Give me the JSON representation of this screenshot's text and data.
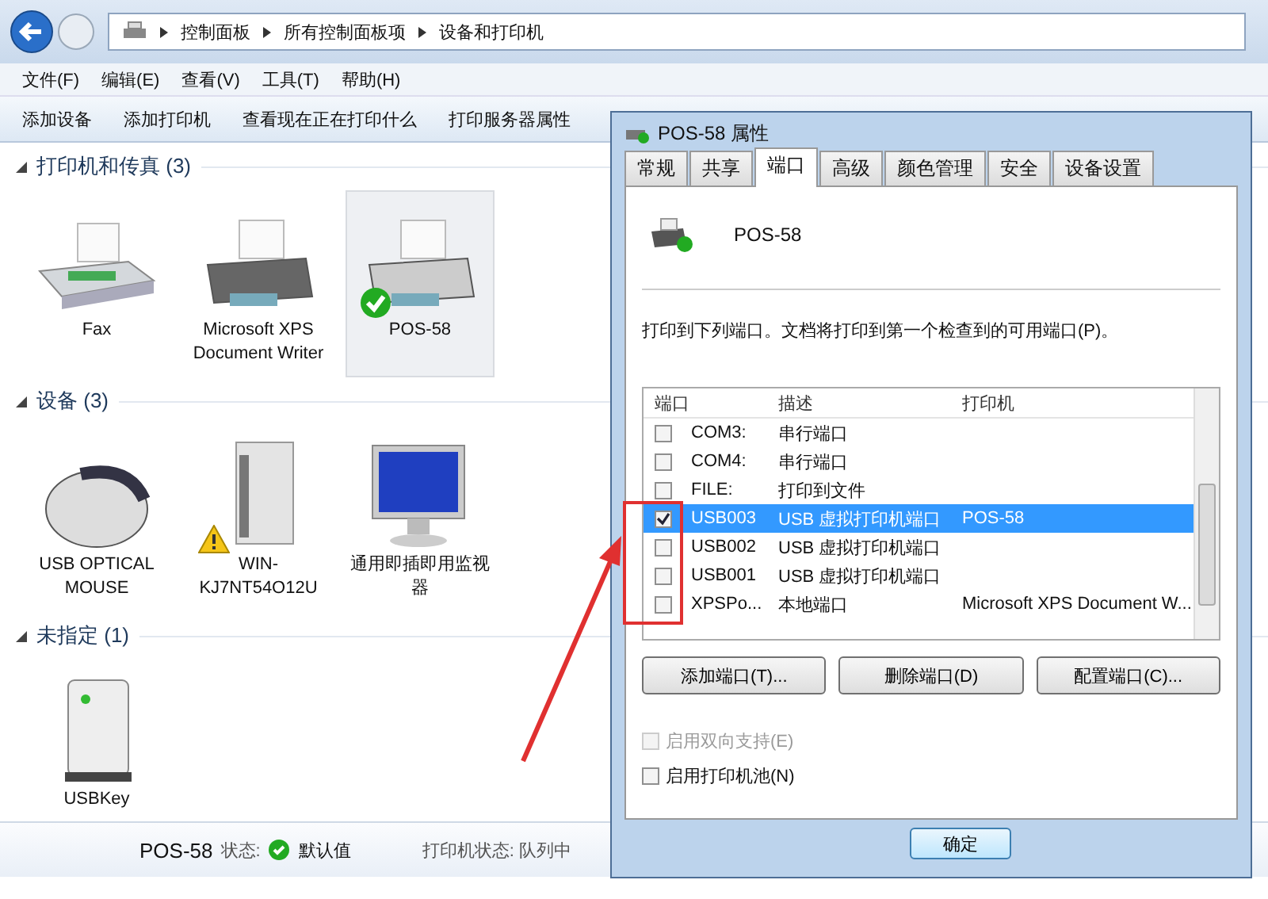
{
  "nav": {
    "breadcrumbs": [
      "控制面板",
      "所有控制面板项",
      "设备和打印机"
    ]
  },
  "menu": [
    "文件(F)",
    "编辑(E)",
    "查看(V)",
    "工具(T)",
    "帮助(H)"
  ],
  "toolbar": [
    "添加设备",
    "添加打印机",
    "查看现在正在打印什么",
    "打印服务器属性"
  ],
  "groups": [
    {
      "title": "打印机和传真 (3)",
      "expanded": true,
      "items": [
        {
          "kind": "fax",
          "label": "Fax",
          "selected": false,
          "is_default": false,
          "warning": false
        },
        {
          "kind": "printer",
          "label": "Microsoft XPS Document Writer",
          "selected": false,
          "is_default": false,
          "warning": false
        },
        {
          "kind": "printer",
          "label": "POS-58",
          "selected": true,
          "is_default": true,
          "warning": false
        }
      ]
    },
    {
      "title": "设备 (3)",
      "expanded": true,
      "items": [
        {
          "kind": "mouse",
          "label": "USB OPTICAL MOUSE",
          "selected": false,
          "is_default": false,
          "warning": false
        },
        {
          "kind": "drive",
          "label": "WIN-KJ7NT54O12U",
          "selected": false,
          "is_default": false,
          "warning": true
        },
        {
          "kind": "monitor",
          "label": "通用即插即用监视器",
          "selected": false,
          "is_default": false,
          "warning": false
        }
      ]
    },
    {
      "title": "未指定 (1)",
      "expanded": true,
      "items": [
        {
          "kind": "box",
          "label": "USBKey",
          "selected": false,
          "is_default": false,
          "warning": false
        }
      ]
    }
  ],
  "details": {
    "name": "POS-58",
    "status_label": "状态:",
    "status_value": "默认值",
    "printer_status": "打印机状态: 队列中"
  },
  "dialog": {
    "title": "POS-58 属性",
    "tabs": [
      {
        "label": "常规",
        "selected": false
      },
      {
        "label": "共享",
        "selected": false
      },
      {
        "label": "端口",
        "selected": true
      },
      {
        "label": "高级",
        "selected": false
      },
      {
        "label": "颜色管理",
        "selected": false
      },
      {
        "label": "安全",
        "selected": false
      },
      {
        "label": "设备设置",
        "selected": false
      }
    ],
    "printer_name": "POS-58",
    "instruction": "打印到下列端口。文档将打印到第一个检查到的可用端口(P)。",
    "columns": [
      "端口",
      "描述",
      "打印机"
    ],
    "ports": [
      {
        "port": "COM3:",
        "description": "串行端口",
        "checked": false,
        "selected": false
      },
      {
        "port": "COM4:",
        "description": "串行端口",
        "checked": false,
        "selected": false
      },
      {
        "port": "FILE:",
        "description": "打印到文件",
        "checked": false,
        "selected": false
      },
      {
        "port": "USB003",
        "description": "USB 虚拟打印机端口",
        "printer": "POS-58",
        "checked": true,
        "selected": true
      },
      {
        "port": "USB002",
        "description": "USB 虚拟打印机端口",
        "checked": false,
        "selected": false
      },
      {
        "port": "USB001",
        "description": "USB 虚拟打印机端口",
        "checked": false,
        "selected": false
      },
      {
        "port": "XPSPo...",
        "description": "本地端口",
        "printer": "Microsoft XPS Document W...",
        "checked": false,
        "selected": false
      }
    ],
    "buttons": [
      "添加端口(T)...",
      "删除端口(D)",
      "配置端口(C)..."
    ],
    "options": [
      {
        "label": "启用双向支持(E)",
        "checked": false,
        "disabled": true
      },
      {
        "label": "启用打印机池(N)",
        "checked": false,
        "disabled": false
      }
    ],
    "ok": "确定"
  }
}
